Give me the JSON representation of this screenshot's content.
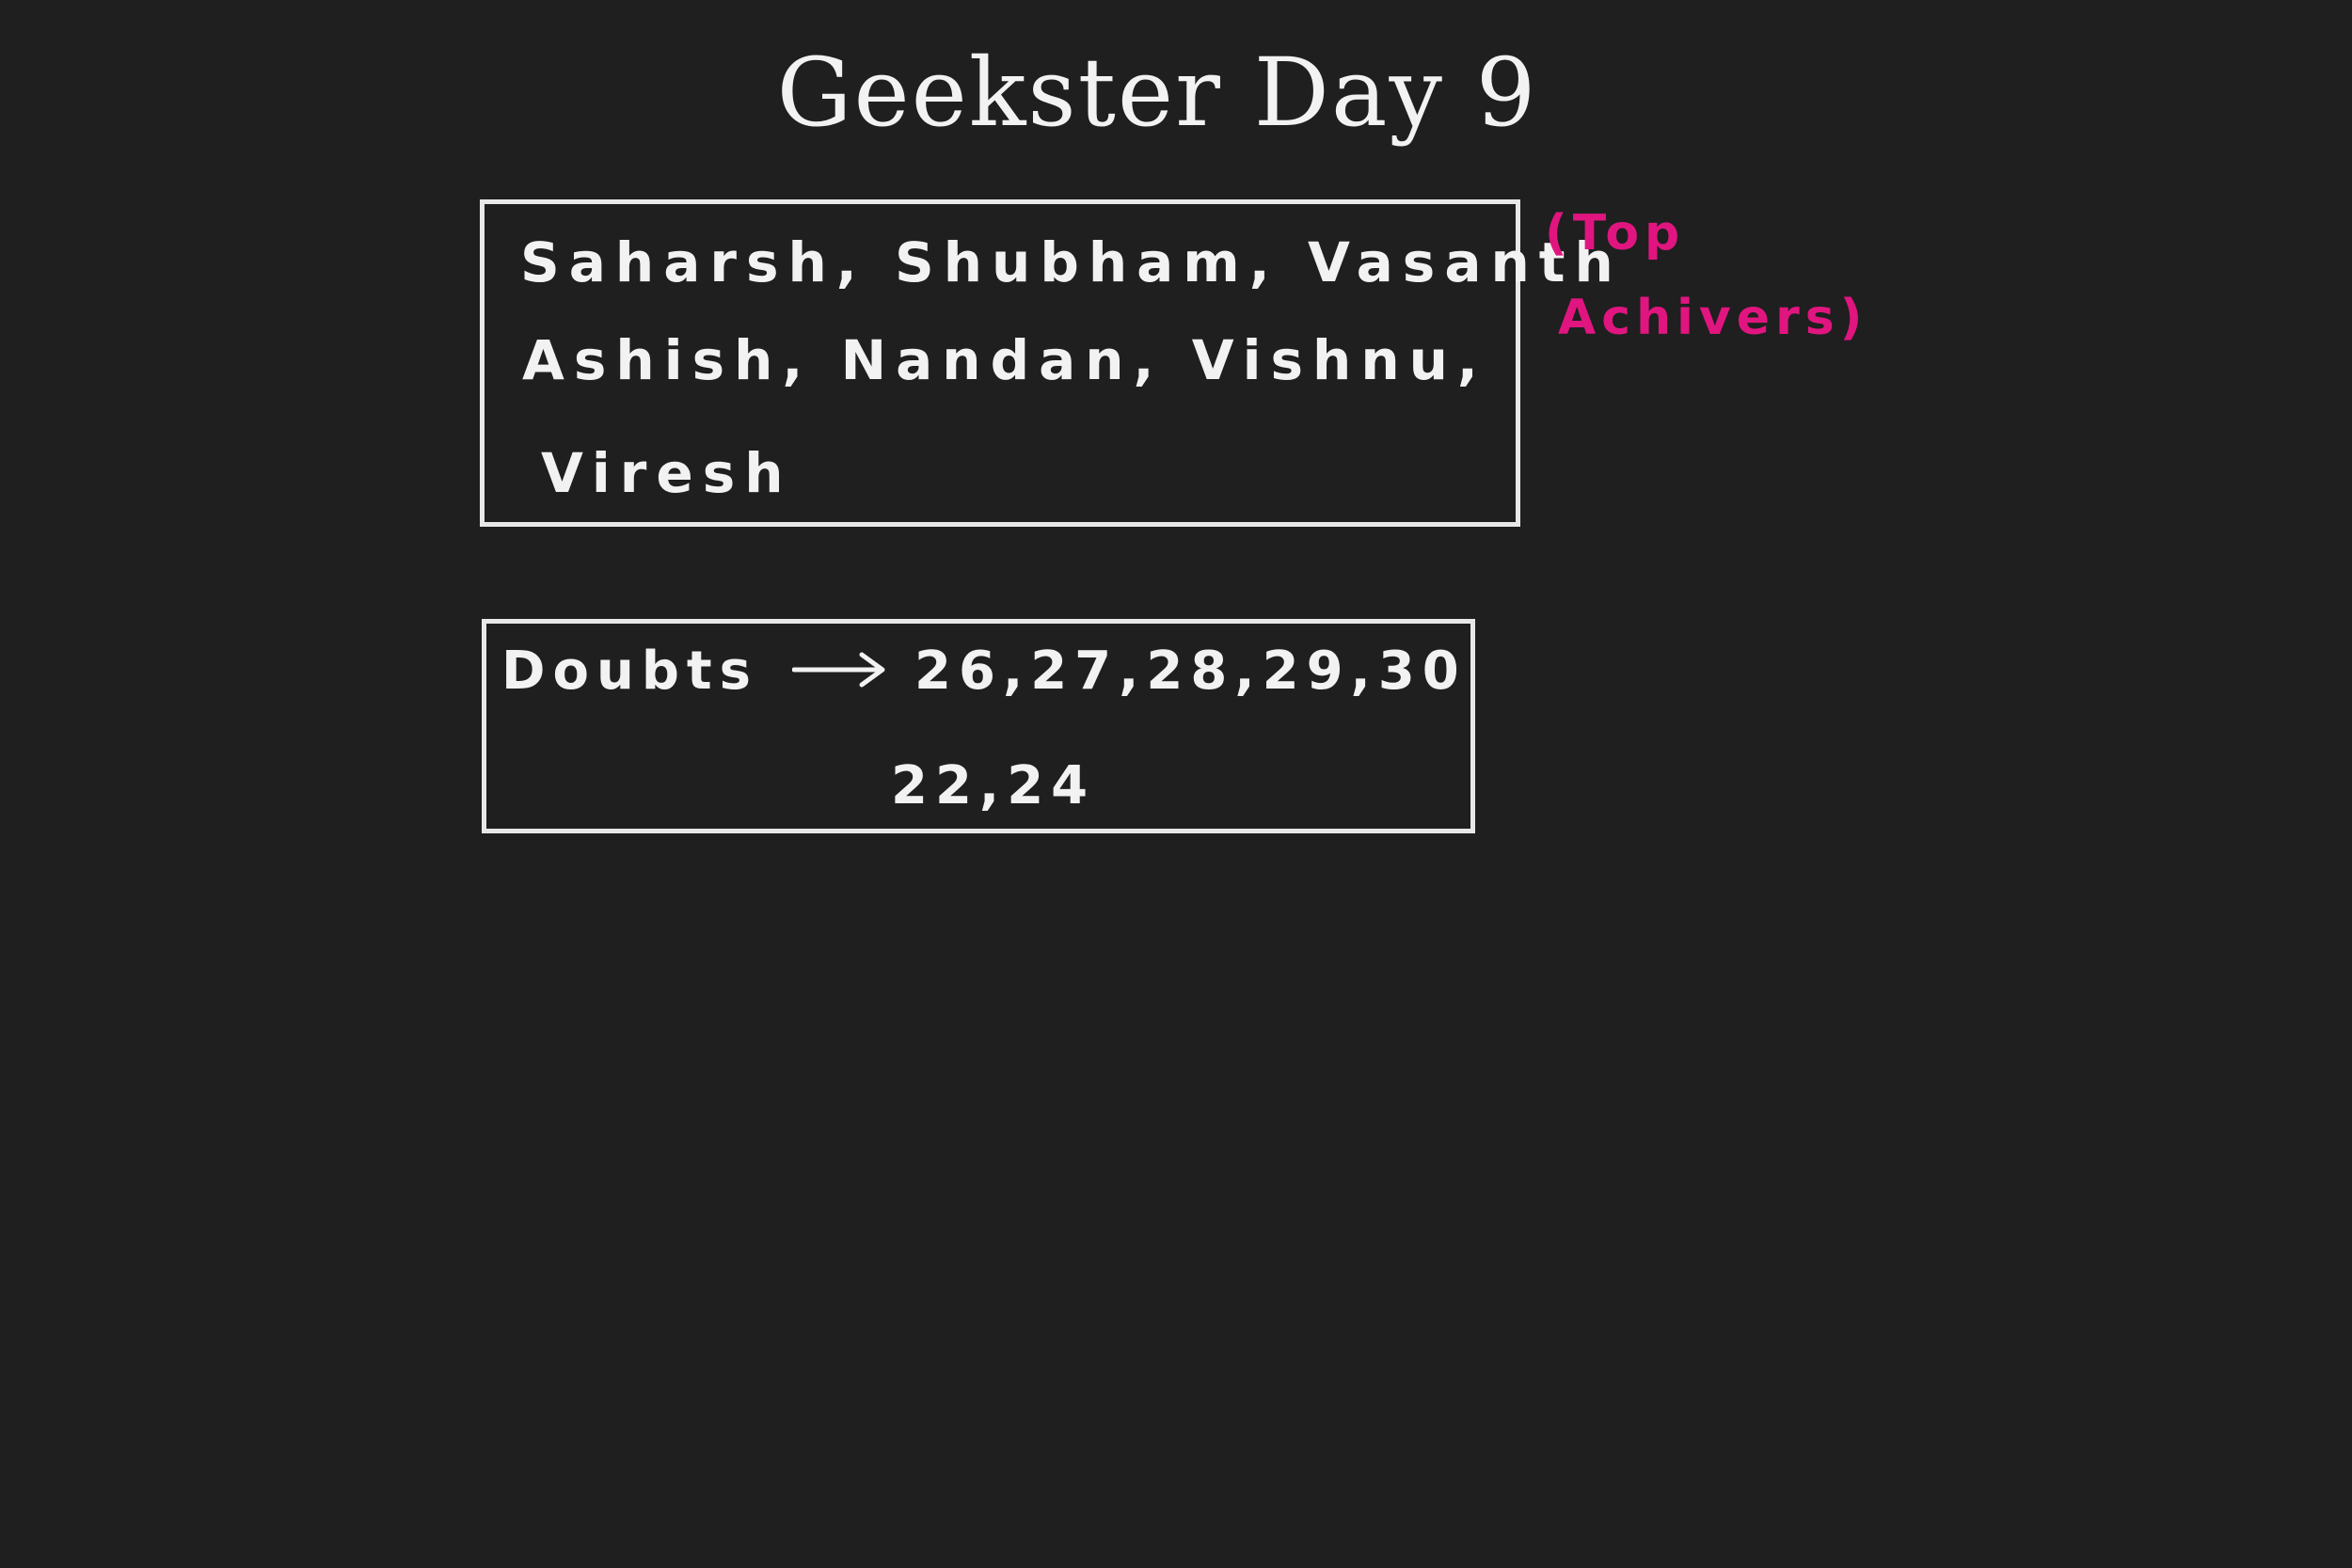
{
  "board": {
    "title": "Geekster Day 9",
    "top_achievers": {
      "lines": [
        "Saharsh, Shubham, Vasanth",
        "Ashish, Nandan, Vishnu,",
        "Viresh"
      ],
      "annotation_line1": "(Top",
      "annotation_line2": "Achivers)"
    },
    "doubts": {
      "label": "Doubts",
      "values_line1": "26,27,28,29,30",
      "values_line2": "22,24"
    },
    "colors": {
      "background": "#1f1f1f",
      "ink": "#f2f2f2",
      "annotation": "#e0157f"
    }
  }
}
